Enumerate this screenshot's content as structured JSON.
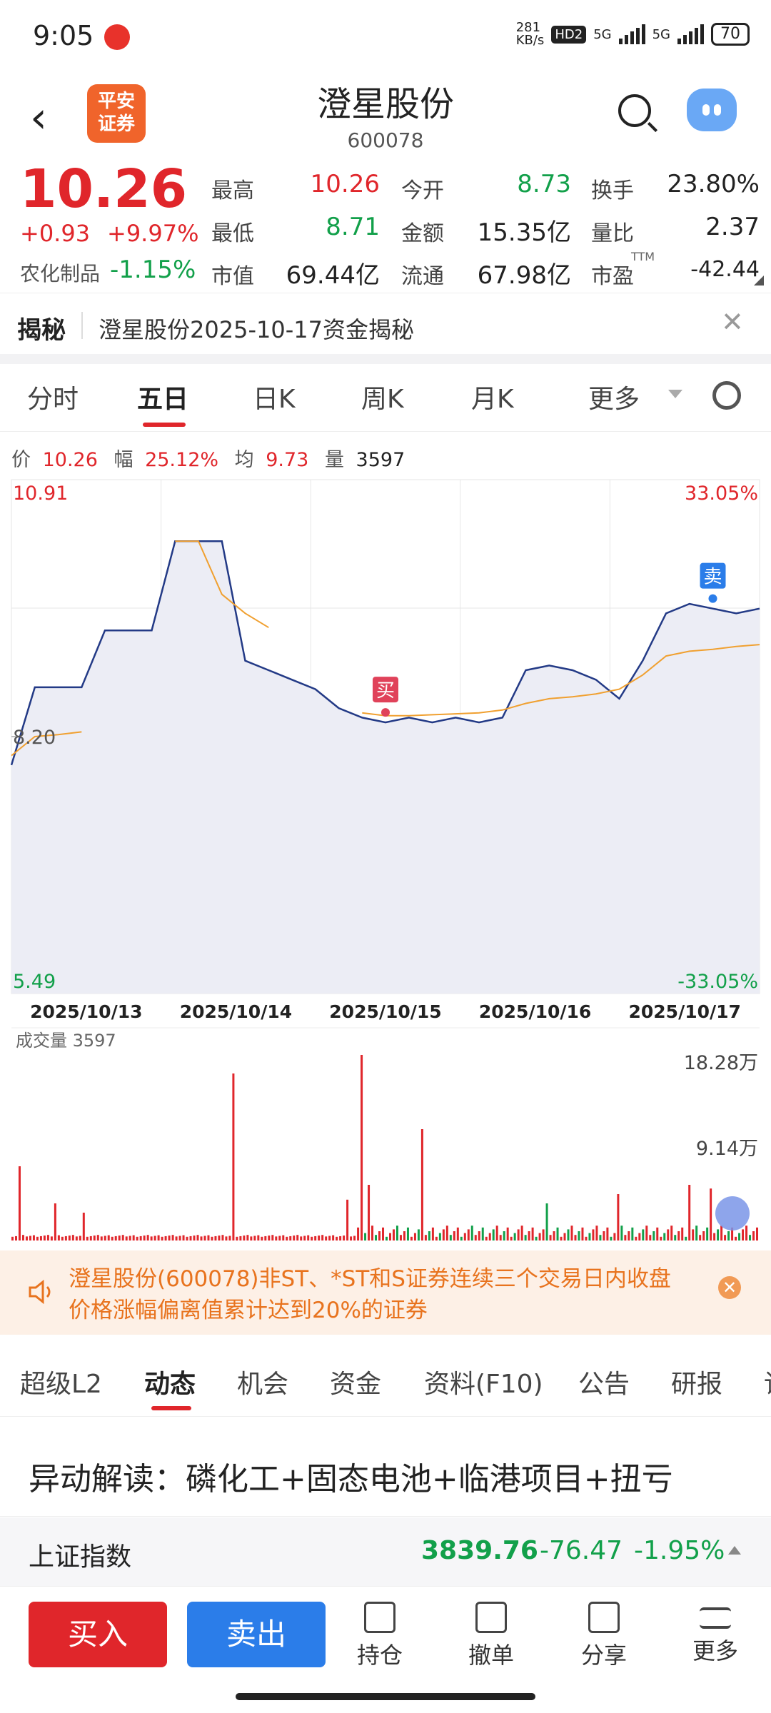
{
  "status": {
    "time": "9:05",
    "speed": "281\nKB/s",
    "hd": "HD2",
    "net1": "5G",
    "net2": "5G",
    "battery": "70"
  },
  "header": {
    "back": "‹",
    "logo": "平安\n证券",
    "title": "澄星股份",
    "code": "600078"
  },
  "quote": {
    "price": "10.26",
    "change": "+0.93",
    "change_pct": "+9.97%",
    "sector_label": "农化制品",
    "sector_pct": "-1.15%",
    "high_label": "最高",
    "high": "10.26",
    "open_label": "今开",
    "open": "8.73",
    "turnover_label": "换手",
    "turnover": "23.80%",
    "low_label": "最低",
    "low": "8.71",
    "amount_label": "金额",
    "amount": "15.35亿",
    "vol_ratio_label": "量比",
    "vol_ratio": "2.37",
    "mcap_label": "市值",
    "mcap": "69.44亿",
    "float_label": "流通",
    "float": "67.98亿",
    "pe_label": "市盈",
    "pe_sup": "TTM",
    "pe": "-42.44"
  },
  "reveal": {
    "tag": "揭秘",
    "text": "澄星股份2025-10-17资金揭秘",
    "close": "✕"
  },
  "chart_tabs": [
    "分时",
    "五日",
    "日K",
    "周K",
    "月K",
    "更多"
  ],
  "chart_tabs_active": 1,
  "chart_info": {
    "price_label": "价",
    "price": "10.26",
    "range_label": "幅",
    "range": "25.12%",
    "avg_label": "均",
    "avg": "9.73",
    "vol_label": "量",
    "vol": "3597"
  },
  "chart_data": {
    "type": "line",
    "title": "",
    "x_labels": [
      "2025/10/13",
      "2025/10/14",
      "2025/10/15",
      "2025/10/16",
      "2025/10/17"
    ],
    "y_left_ticks": [
      "10.91",
      "8.20",
      "5.49"
    ],
    "y_right_ticks": [
      "33.05%",
      "-33.05%"
    ],
    "ylim": [
      5.49,
      10.91
    ],
    "prev_close": 8.2,
    "series": [
      {
        "name": "price",
        "values": [
          7.9,
          8.72,
          8.72,
          8.72,
          9.32,
          9.32,
          9.32,
          10.26,
          10.26,
          10.26,
          9.0,
          8.9,
          8.8,
          8.7,
          8.5,
          8.4,
          8.35,
          8.4,
          8.35,
          8.4,
          8.35,
          8.4,
          8.9,
          8.95,
          8.9,
          8.8,
          8.6,
          9.0,
          9.5,
          9.6,
          9.55,
          9.5,
          9.55
        ]
      },
      {
        "name": "avg",
        "values": [
          8.0,
          8.2,
          8.22,
          8.25,
          null,
          null,
          null,
          10.26,
          10.26,
          9.7,
          9.5,
          9.35,
          null,
          null,
          null,
          8.45,
          8.42,
          8.42,
          8.43,
          8.44,
          8.45,
          8.48,
          8.55,
          8.6,
          8.62,
          8.65,
          8.7,
          8.85,
          9.05,
          9.1,
          9.12,
          9.15,
          9.17
        ]
      }
    ],
    "markers": [
      {
        "label": "买"
      },
      {
        "label": "卖"
      }
    ],
    "volume": {
      "label": "成交量",
      "value": "3597",
      "ticks": [
        "18.28万",
        "9.14万"
      ]
    }
  },
  "alert": {
    "text": "澄星股份(600078)非ST、*ST和S证券连续三个交易日内收盘价格涨幅偏离值累计达到20%的证券"
  },
  "bottom_tabs": [
    "超级L2",
    "动态",
    "机会",
    "资金",
    "资料(F10)",
    "公告",
    "研报",
    "讨"
  ],
  "bottom_tabs_active": 1,
  "interpretation": "异动解读：磷化工+固态电池+临港项目+扭亏",
  "index": {
    "name": "上证指数",
    "value": "3839.76",
    "change": "-76.47",
    "pct": "-1.95%"
  },
  "actions": {
    "buy": "买入",
    "sell": "卖出",
    "hold": "持仓",
    "cancel": "撤单",
    "share": "分享",
    "more": "更多"
  },
  "colors": {
    "up": "#e0262b",
    "down": "#12a04a",
    "accent": "#f0642b",
    "sell_btn": "#2b7de9"
  }
}
